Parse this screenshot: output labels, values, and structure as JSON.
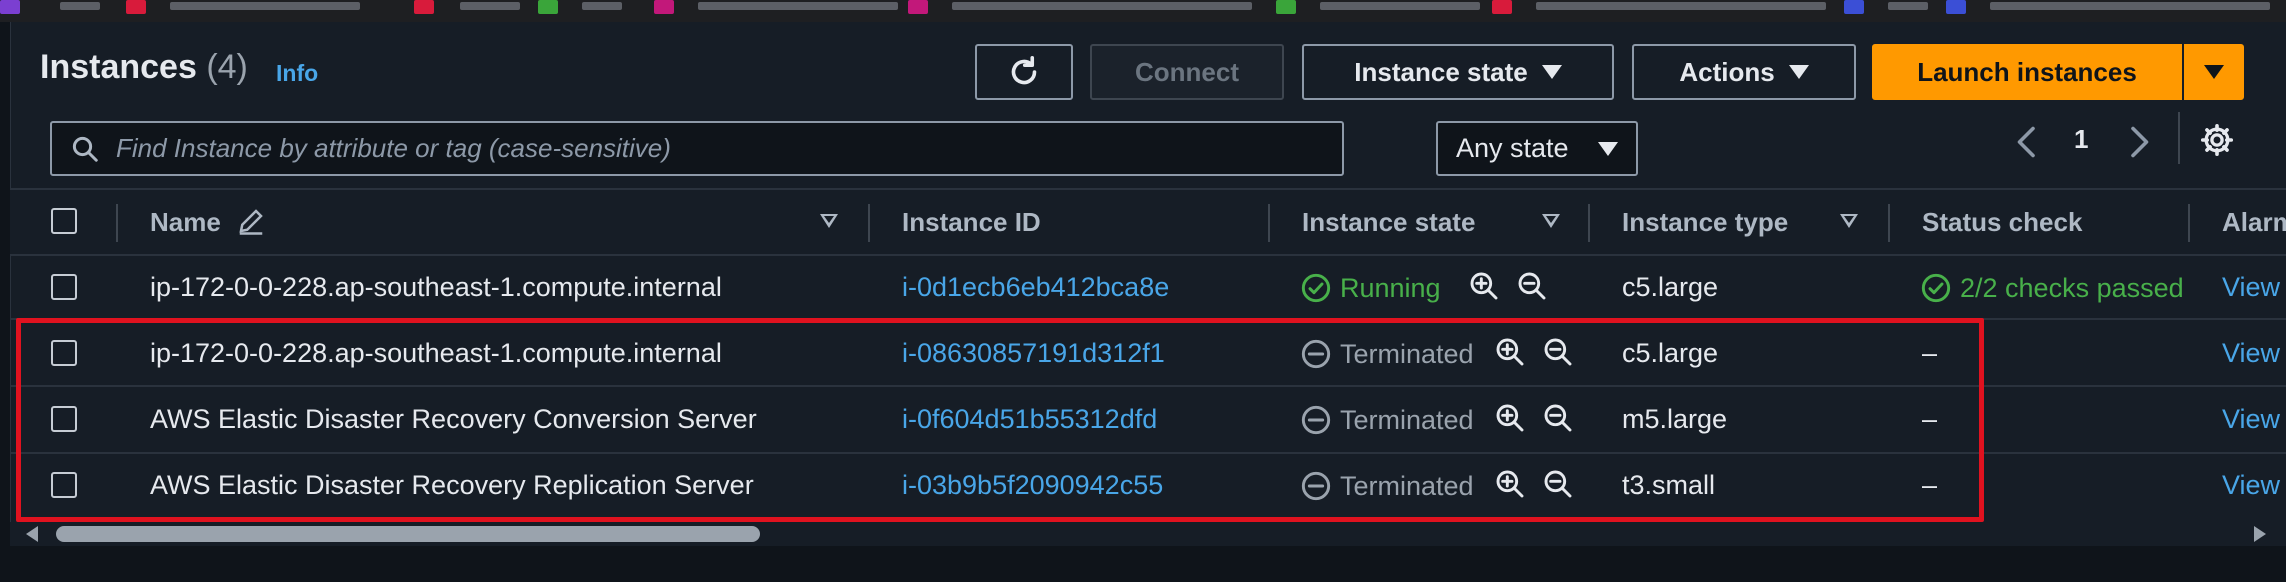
{
  "header": {
    "title": "Instances",
    "count": "(4)",
    "info_label": "Info"
  },
  "toolbar": {
    "refresh_icon": "refresh-icon",
    "connect_label": "Connect",
    "instance_state_label": "Instance state",
    "actions_label": "Actions",
    "launch_label": "Launch instances"
  },
  "filter": {
    "search_placeholder": "Find Instance by attribute or tag (case-sensitive)",
    "state_select": "Any state"
  },
  "pagination": {
    "page": "1"
  },
  "table": {
    "columns": {
      "name": "Name",
      "instance_id": "Instance ID",
      "instance_state": "Instance state",
      "instance_type": "Instance type",
      "status_check": "Status check",
      "alarm": "Alarm"
    },
    "rows": [
      {
        "name": "ip-172-0-0-228.ap-southeast-1.compute.internal",
        "instance_id": "i-0d1ecb6eb412bca8e",
        "state": "Running",
        "type": "c5.large",
        "status": "2/2 checks passed",
        "alarm": "View"
      },
      {
        "name": "ip-172-0-0-228.ap-southeast-1.compute.internal",
        "instance_id": "i-08630857191d312f1",
        "state": "Terminated",
        "type": "c5.large",
        "status": "–",
        "alarm": "View"
      },
      {
        "name": "AWS Elastic Disaster Recovery Conversion Server",
        "instance_id": "i-0f604d51b55312dfd",
        "state": "Terminated",
        "type": "m5.large",
        "status": "–",
        "alarm": "View"
      },
      {
        "name": "AWS Elastic Disaster Recovery Replication Server",
        "instance_id": "i-03b9b5f2090942c55",
        "state": "Terminated",
        "type": "t3.small",
        "status": "–",
        "alarm": "View"
      }
    ]
  },
  "colors": {
    "accent_orange": "#ff9900",
    "link_blue": "#49a6e8",
    "running_green": "#48b04a",
    "highlight_red": "#e0121f"
  }
}
